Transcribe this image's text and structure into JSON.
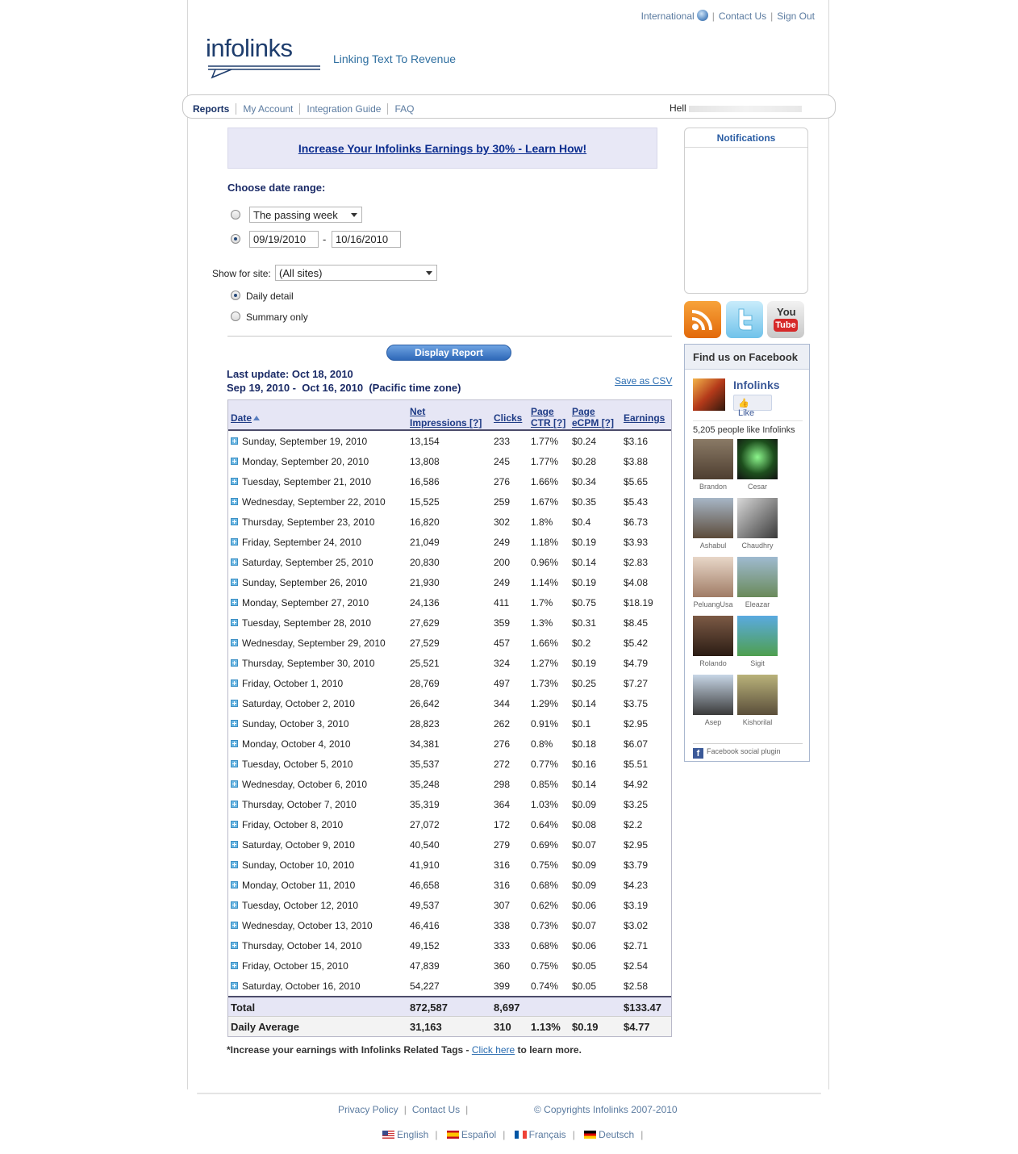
{
  "top_links": {
    "international": "International",
    "contact": "Contact Us",
    "signout": "Sign Out"
  },
  "brand": {
    "logo": "infolinks",
    "tagline": "Linking Text To Revenue",
    "color": "#1e3d6d"
  },
  "nav": {
    "items": [
      "Reports",
      "My Account",
      "Integration Guide",
      "FAQ"
    ],
    "active": "Reports",
    "greeting": "Hell"
  },
  "promo": {
    "text": "Increase Your Infolinks Earnings by 30% - Learn How!"
  },
  "date_form": {
    "title": "Choose date range:",
    "preset_value": "The passing week",
    "from": "09/19/2010",
    "dash": "-",
    "to": "10/16/2010",
    "site_label": "Show for site:",
    "site_value": "(All sites)",
    "opt_daily": "Daily detail",
    "opt_summary": "Summary only",
    "display_button": "Display Report"
  },
  "report_meta": {
    "last_update": "Last update: Oct 18, 2010",
    "range": "Sep 19, 2010 -  Oct 16, 2010  (Pacific time zone)",
    "csv": "Save as CSV"
  },
  "table": {
    "headers": {
      "date": "Date",
      "impressions_1": "Net",
      "impressions_2": "Impressions",
      "help": "[?]",
      "clicks": "Clicks",
      "ctr_1": "Page",
      "ctr_2": "CTR",
      "ecpm_1": "Page",
      "ecpm_2": "eCPM",
      "earnings": "Earnings"
    },
    "rows": [
      [
        "Sunday, September 19, 2010",
        "13,154",
        "233",
        "1.77%",
        "$0.24",
        "$3.16"
      ],
      [
        "Monday, September 20, 2010",
        "13,808",
        "245",
        "1.77%",
        "$0.28",
        "$3.88"
      ],
      [
        "Tuesday, September 21, 2010",
        "16,586",
        "276",
        "1.66%",
        "$0.34",
        "$5.65"
      ],
      [
        "Wednesday, September 22, 2010",
        "15,525",
        "259",
        "1.67%",
        "$0.35",
        "$5.43"
      ],
      [
        "Thursday, September 23, 2010",
        "16,820",
        "302",
        "1.8%",
        "$0.4",
        "$6.73"
      ],
      [
        "Friday, September 24, 2010",
        "21,049",
        "249",
        "1.18%",
        "$0.19",
        "$3.93"
      ],
      [
        "Saturday, September 25, 2010",
        "20,830",
        "200",
        "0.96%",
        "$0.14",
        "$2.83"
      ],
      [
        "Sunday, September 26, 2010",
        "21,930",
        "249",
        "1.14%",
        "$0.19",
        "$4.08"
      ],
      [
        "Monday, September 27, 2010",
        "24,136",
        "411",
        "1.7%",
        "$0.75",
        "$18.19"
      ],
      [
        "Tuesday, September 28, 2010",
        "27,629",
        "359",
        "1.3%",
        "$0.31",
        "$8.45"
      ],
      [
        "Wednesday, September 29, 2010",
        "27,529",
        "457",
        "1.66%",
        "$0.2",
        "$5.42"
      ],
      [
        "Thursday, September 30, 2010",
        "25,521",
        "324",
        "1.27%",
        "$0.19",
        "$4.79"
      ],
      [
        "Friday, October 1, 2010",
        "28,769",
        "497",
        "1.73%",
        "$0.25",
        "$7.27"
      ],
      [
        "Saturday, October 2, 2010",
        "26,642",
        "344",
        "1.29%",
        "$0.14",
        "$3.75"
      ],
      [
        "Sunday, October 3, 2010",
        "28,823",
        "262",
        "0.91%",
        "$0.1",
        "$2.95"
      ],
      [
        "Monday, October 4, 2010",
        "34,381",
        "276",
        "0.8%",
        "$0.18",
        "$6.07"
      ],
      [
        "Tuesday, October 5, 2010",
        "35,537",
        "272",
        "0.77%",
        "$0.16",
        "$5.51"
      ],
      [
        "Wednesday, October 6, 2010",
        "35,248",
        "298",
        "0.85%",
        "$0.14",
        "$4.92"
      ],
      [
        "Thursday, October 7, 2010",
        "35,319",
        "364",
        "1.03%",
        "$0.09",
        "$3.25"
      ],
      [
        "Friday, October 8, 2010",
        "27,072",
        "172",
        "0.64%",
        "$0.08",
        "$2.2"
      ],
      [
        "Saturday, October 9, 2010",
        "40,540",
        "279",
        "0.69%",
        "$0.07",
        "$2.95"
      ],
      [
        "Sunday, October 10, 2010",
        "41,910",
        "316",
        "0.75%",
        "$0.09",
        "$3.79"
      ],
      [
        "Monday, October 11, 2010",
        "46,658",
        "316",
        "0.68%",
        "$0.09",
        "$4.23"
      ],
      [
        "Tuesday, October 12, 2010",
        "49,537",
        "307",
        "0.62%",
        "$0.06",
        "$3.19"
      ],
      [
        "Wednesday, October 13, 2010",
        "46,416",
        "338",
        "0.73%",
        "$0.07",
        "$3.02"
      ],
      [
        "Thursday, October 14, 2010",
        "49,152",
        "333",
        "0.68%",
        "$0.06",
        "$2.71"
      ],
      [
        "Friday, October 15, 2010",
        "47,839",
        "360",
        "0.75%",
        "$0.05",
        "$2.54"
      ],
      [
        "Saturday, October 16, 2010",
        "54,227",
        "399",
        "0.74%",
        "$0.05",
        "$2.58"
      ]
    ],
    "total": {
      "label": "Total",
      "impressions": "872,587",
      "clicks": "8,697",
      "ctr": "",
      "ecpm": "",
      "earnings": "$133.47"
    },
    "average": {
      "label": "Daily Average",
      "impressions": "31,163",
      "clicks": "310",
      "ctr": "1.13%",
      "ecpm": "$0.19",
      "earnings": "$4.77"
    }
  },
  "note": {
    "text": "*Increase your earnings with Infolinks Related Tags - ",
    "link": "Click here",
    "tail": " to learn more."
  },
  "sidebar": {
    "notifications": "Notifications",
    "icons": [
      "rss-icon",
      "twitter-icon",
      "youtube-icon"
    ],
    "youtube_1": "You",
    "youtube_2": "Tube",
    "facebook": {
      "header": "Find us on Facebook",
      "page_name": "Infolinks",
      "like": "Like",
      "count": "5,205 people like Infolinks",
      "fans": [
        "Brandon",
        "Cesar",
        "Ashabul",
        "Chaudhry",
        "PeluangUsa",
        "Eleazar",
        "Rolando",
        "Sigit",
        "Asep",
        "Kishorilal"
      ],
      "plugin": "Facebook social plugin"
    }
  },
  "footer": {
    "privacy": "Privacy Policy",
    "contact": "Contact Us",
    "copyright": "© Copyrights Infolinks 2007-2010",
    "languages": [
      "English",
      "Español",
      "Français",
      "Deutsch"
    ]
  }
}
